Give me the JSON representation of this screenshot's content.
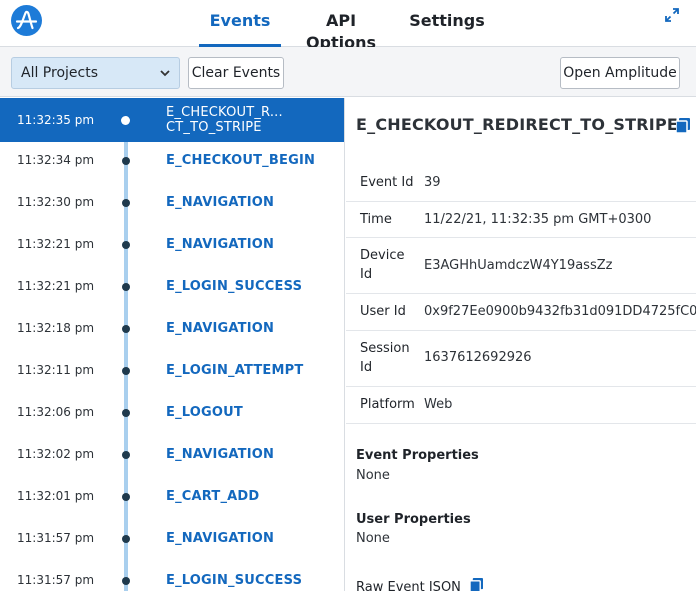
{
  "header": {
    "logo_icon": "amplitude-logo-icon",
    "tabs": [
      {
        "label": "Events",
        "active": true
      },
      {
        "label": "API Options",
        "active": false
      },
      {
        "label": "Settings",
        "active": false
      }
    ],
    "expand_icon": "expand-arrows-icon",
    "accent_color": "#1368be"
  },
  "toolbar": {
    "project_select": "All Projects",
    "clear_label": "Clear Events",
    "open_label": "Open Amplitude"
  },
  "events": [
    {
      "time": "11:32:35 pm",
      "name": "E_CHECKOUT_R...",
      "name2": "CT_TO_STRIPE",
      "selected": true
    },
    {
      "time": "11:32:34 pm",
      "name": "E_CHECKOUT_BEGIN"
    },
    {
      "time": "11:32:30 pm",
      "name": "E_NAVIGATION"
    },
    {
      "time": "11:32:21 pm",
      "name": "E_NAVIGATION"
    },
    {
      "time": "11:32:21 pm",
      "name": "E_LOGIN_SUCCESS"
    },
    {
      "time": "11:32:18 pm",
      "name": "E_NAVIGATION"
    },
    {
      "time": "11:32:11 pm",
      "name": "E_LOGIN_ATTEMPT"
    },
    {
      "time": "11:32:06 pm",
      "name": "E_LOGOUT"
    },
    {
      "time": "11:32:02 pm",
      "name": "E_NAVIGATION"
    },
    {
      "time": "11:32:01 pm",
      "name": "E_CART_ADD"
    },
    {
      "time": "11:31:57 pm",
      "name": "E_NAVIGATION"
    },
    {
      "time": "11:31:57 pm",
      "name": "E_LOGIN_SUCCESS"
    }
  ],
  "detail": {
    "title": "E_CHECKOUT_REDIRECT_TO_STRIPE",
    "props": [
      {
        "key": "Event Id",
        "value": "39"
      },
      {
        "key": "Time",
        "value": "11/22/21, 11:32:35 pm GMT+0300"
      },
      {
        "key": "Device",
        "key2": "Id",
        "value": "E3AGHhUamdczW4Y19assZz"
      },
      {
        "key": "User Id",
        "value": "0x9f27Ee0900b9432fb31d091DD4725fC0"
      },
      {
        "key": "Session",
        "key2": "Id",
        "value": "1637612692926"
      },
      {
        "key": "Platform",
        "value": "Web"
      }
    ],
    "event_properties_label": "Event Properties",
    "event_properties_value": "None",
    "user_properties_label": "User Properties",
    "user_properties_value": "None",
    "raw_json_label": "Raw Event JSON"
  }
}
